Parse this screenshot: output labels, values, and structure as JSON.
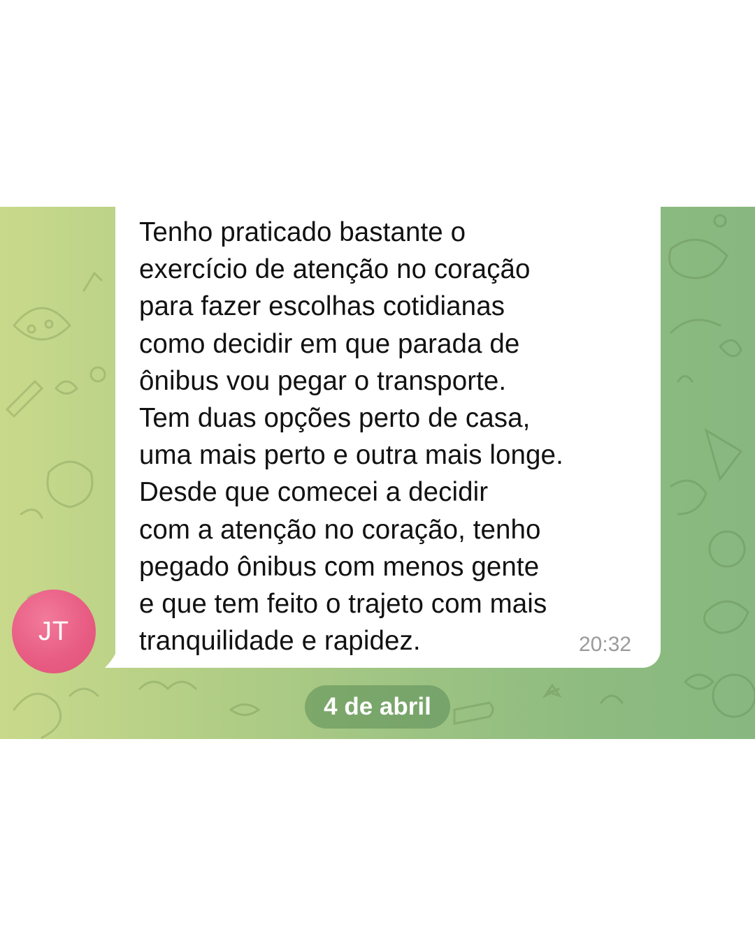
{
  "chat": {
    "message": {
      "text": "Tenho praticado bastante o\nexercício de atenção no coração\npara fazer escolhas cotidianas\ncomo decidir em que parada  de\nônibus vou pegar o transporte.\nTem duas opções perto de casa,\numa mais perto e outra mais longe.\nDesde que comecei a decidir\ncom a atenção no coração, tenho\npegado ônibus com menos gente\ne que tem feito o trajeto com mais\ntranquilidade e rapidez.",
      "time": "20:32"
    },
    "sender": {
      "initials": "JT"
    },
    "date_separator": "4 de abril"
  },
  "colors": {
    "avatar": "#e85d84",
    "bubble": "#ffffff",
    "wallpaper_left": "#c9d98b",
    "wallpaper_right": "#88b880"
  }
}
